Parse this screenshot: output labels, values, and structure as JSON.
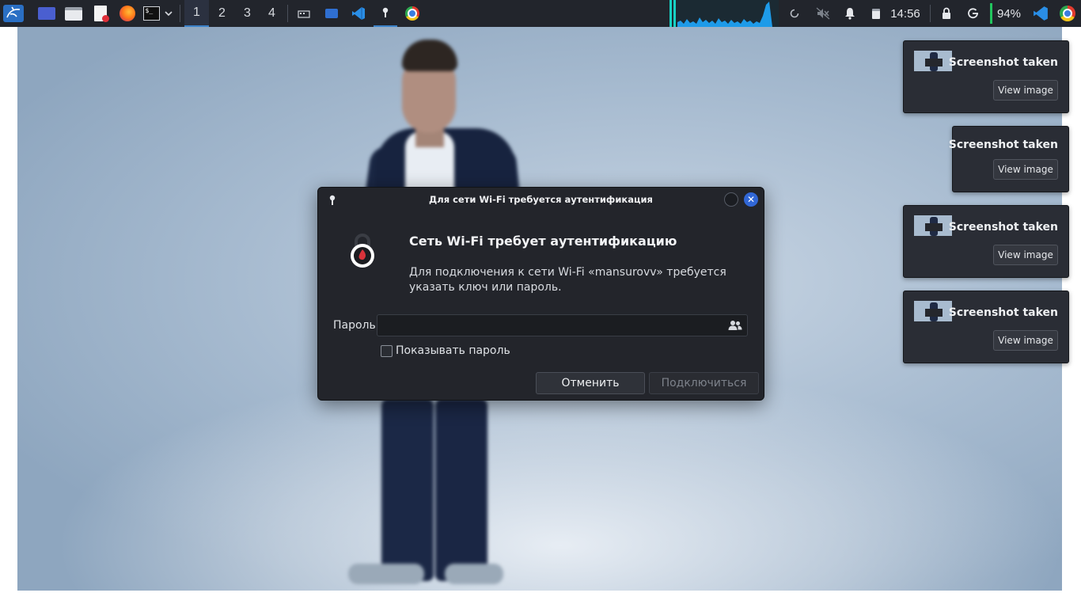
{
  "panel": {
    "workspaces": [
      "1",
      "2",
      "3",
      "4"
    ],
    "active_workspace": "1",
    "clock": "14:56",
    "battery": "94%",
    "launchers": [
      "kali-menu-icon",
      "desktop-icon",
      "file-manager-icon",
      "text-editor-icon",
      "firefox-icon",
      "terminal-icon"
    ],
    "tasks": [
      "screen-capture-icon",
      "remote-desktop-icon",
      "vscode-icon",
      "nm-auth-icon",
      "chrome-icon"
    ],
    "tray": [
      "refresh-icon",
      "mute-icon",
      "bell-icon",
      "clipboard-icon",
      "lock-icon",
      "power-icon"
    ]
  },
  "dialog": {
    "title": "Для сети Wi-Fi требуется аутентификация",
    "heading": "Сеть Wi-Fi требует аутентификацию",
    "description": "Для подключения к сети Wi-Fi «mansurovv» требуется указать ключ или пароль.",
    "password_label": "Пароль",
    "password_value": "",
    "show_password_label": "Показывать пароль",
    "show_password_checked": false,
    "cancel_label": "Отменить",
    "connect_label": "Подключиться",
    "connect_enabled": false
  },
  "notifications": [
    {
      "title": "Screenshot taken",
      "button": "View image",
      "thumbnail": true
    },
    {
      "title": "Screenshot taken",
      "button": "View image",
      "thumbnail": false
    },
    {
      "title": "Screenshot taken",
      "button": "View image",
      "thumbnail": true
    },
    {
      "title": "Screenshot taken",
      "button": "View image",
      "thumbnail": true
    }
  ],
  "colors": {
    "panel_bg": "#22252c",
    "accent": "#3b82c9",
    "dialog_bg": "#23252b",
    "close_button": "#3167d6",
    "lock_red": "#d8323a",
    "battery_green": "#22c55e",
    "netgraph_blue": "#1e9be9"
  }
}
